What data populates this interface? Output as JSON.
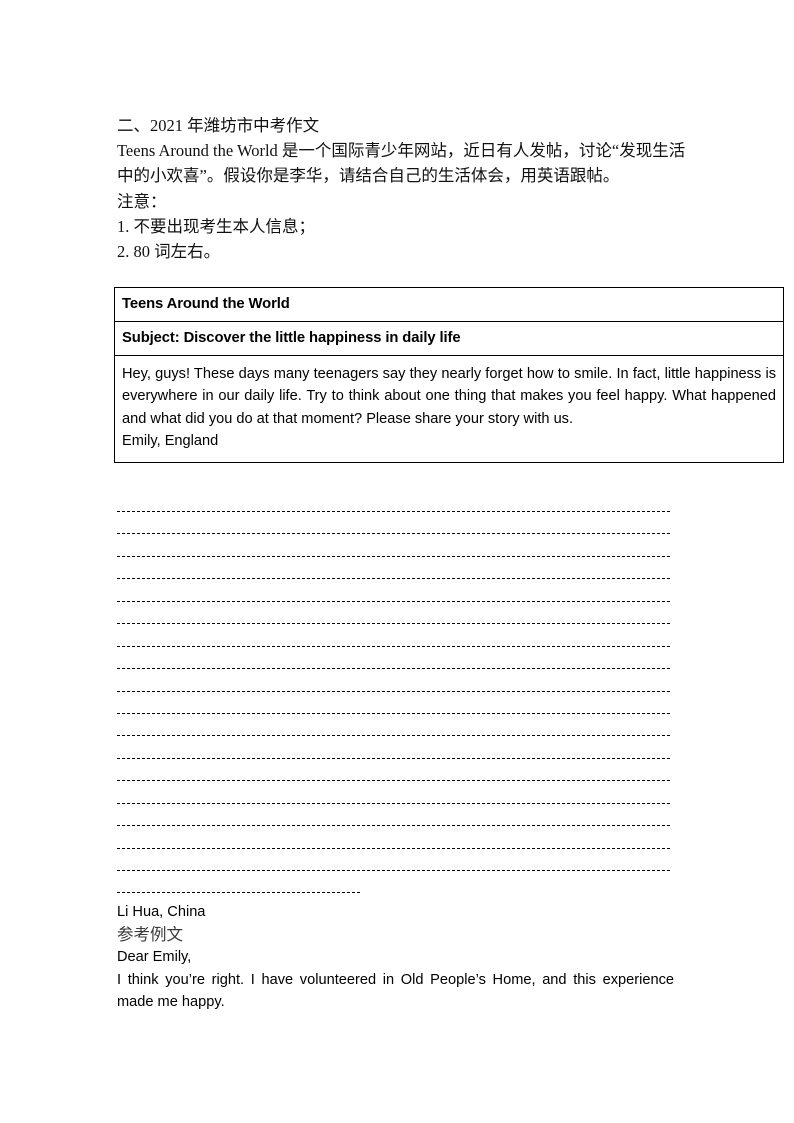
{
  "document": {
    "section_heading": "二、2021 年潍坊市中考作文",
    "prompt_lines": [
      "Teens Around the World 是一个国际青少年网站，近日有人发帖，讨论“发现生活中的小欢喜”。假设你是李华，请结合自己的生活体会，用英语跟帖。"
    ],
    "notes_label": "注意：",
    "notes": [
      "1. 不要出现考生本人信息；",
      "2. 80 词左右。"
    ]
  },
  "post": {
    "site_title": "Teens Around the World",
    "subject": "Subject: Discover the little happiness in daily life",
    "body": "Hey, guys! These days many teenagers say they nearly forget how to smile. In fact, little happiness is everywhere in our daily life. Try to think about one thing that makes you feel happy. What happened and what did you do at that moment? Please share your story with us.",
    "signature": "Emily, England"
  },
  "answer_area": {
    "full_line_count": 17,
    "short_line_count": 1
  },
  "closing": {
    "signature": "Li Hua, China",
    "sample_label": "参考例文",
    "salutation": "Dear Emily,",
    "sample_text": "I think you’re right. I have volunteered in Old People’s Home, and this experience made me happy."
  },
  "colors": {
    "text": "#000000",
    "muted_cjk": "#3a3a3a",
    "rule": "#000000",
    "border": "#000000",
    "page": "#ffffff"
  }
}
